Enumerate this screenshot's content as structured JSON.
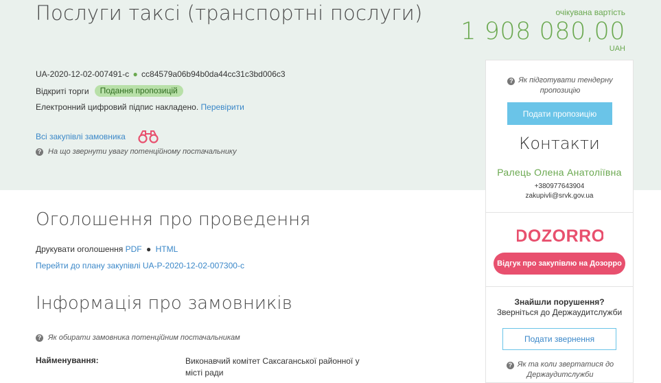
{
  "tender": {
    "title": "Послуги таксі (транспортні послуги)",
    "expected_label": "очікувана вартість",
    "expected_amount": "1 908 080,00",
    "currency": "UAH",
    "id": "UA-2020-12-02-007491-c",
    "hash": "cc84579a06b94b0da44cc31c3bd006c3",
    "procedure_type": "Відкриті торги",
    "status": "Подання пропозицій",
    "signature_text": "Електронний цифровий підпис накладено.",
    "verify_link": "Перевірити",
    "all_purchases_link": "Всі закупівлі замовника",
    "supplier_hint": "На що звернути увагу потенційному постачальнику"
  },
  "announcement": {
    "title": "Оголошення про проведення",
    "print_label": "Друкувати оголошення",
    "pdf_link": "PDF",
    "html_link": "HTML",
    "plan_link": "Перейти до плану закупівлі UA-P-2020-12-02-007300-c"
  },
  "customers": {
    "title": "Інформація про замовників",
    "hint": "Як обирати замовника потенційним постачальникам",
    "name_label": "Найменування:",
    "name_value": "Виконавчий комітет Саксаганської районної у місті ради"
  },
  "sidebar": {
    "prep_hint": "Як підготувати тендерну пропозицію",
    "bid_button": "Подати пропозицію",
    "contacts_title": "Контакти",
    "contact_name": "Ралець Олена Анатоліївна",
    "contact_phone": "+380977643904",
    "contact_email": "zakupivli@srvk.gov.ua",
    "dozorro_logo_text": "DOZORRO",
    "dozorro_button": "Відгук про закупівлю на Дозорро",
    "violations_title": "Знайшли порушення?",
    "violations_sub": "Зверніться до Держаудитслужби",
    "complaint_button": "Подати звернення",
    "audit_hint": "Як та коли звертатися до Держаудитслужби"
  },
  "colors": {
    "band": "#eaf1ed",
    "accent_green": "#6aa84f",
    "link_blue": "#3a87c8",
    "button_blue": "#6ac4e8",
    "dozorro_pink": "#e8506e"
  },
  "icons": {
    "binoculars": "binoculars-icon",
    "help": "question-circle-icon"
  }
}
